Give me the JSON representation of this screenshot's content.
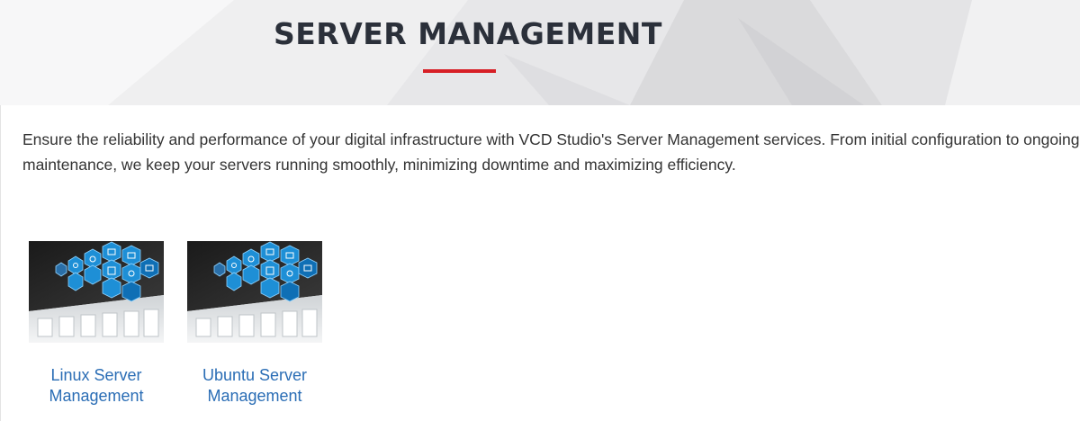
{
  "banner": {
    "title": "SERVER MANAGEMENT",
    "accent_color": "#d71f26"
  },
  "intro": {
    "text": "Ensure the reliability and performance of your digital infrastructure with VCD Studio's Server Management services. From initial configuration to ongoing maintenance, we keep your servers running smoothly, minimizing downtime and maximizing efficiency."
  },
  "services": [
    {
      "label": "Linux Server Management",
      "icon": "server-network-thumbnail"
    },
    {
      "label": "Ubuntu Server Management",
      "icon": "server-network-thumbnail"
    }
  ],
  "colors": {
    "link": "#2a6db5",
    "heading": "#2b303a",
    "body_text": "#333333"
  }
}
